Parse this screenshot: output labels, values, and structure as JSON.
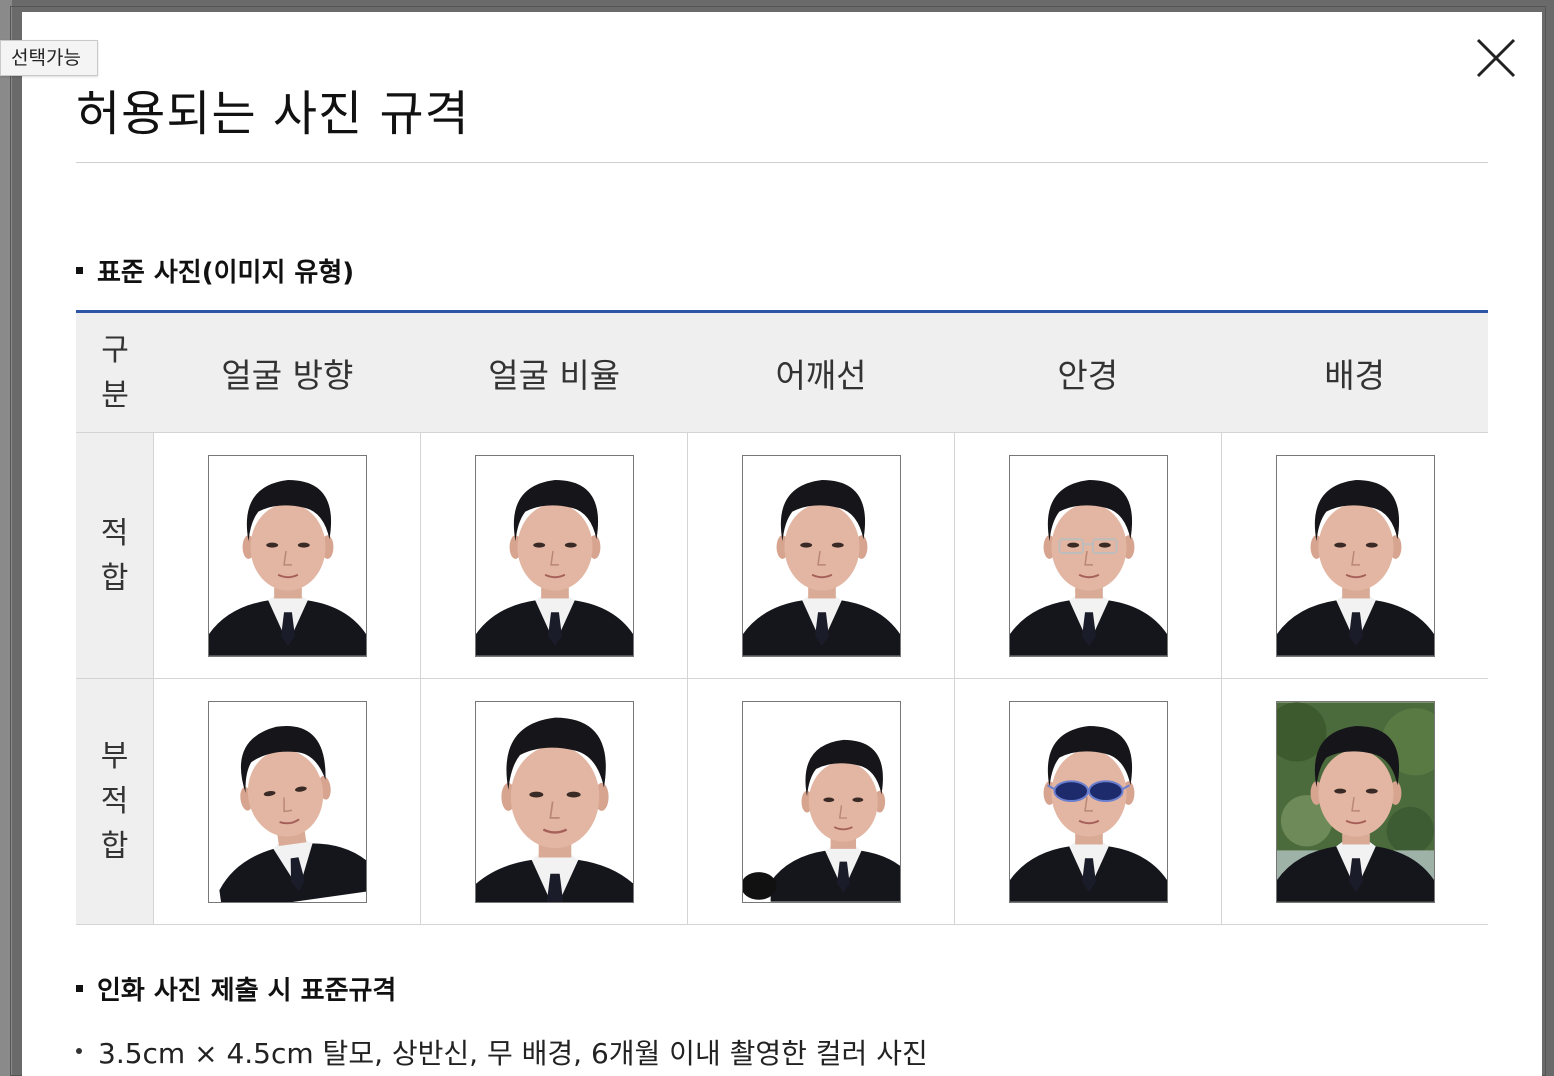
{
  "tooltip": "선택가능",
  "modal": {
    "title": "허용되는 사진 규격",
    "close_label": "닫기"
  },
  "section1": {
    "heading": "표준 사진(이미지 유형)"
  },
  "table": {
    "corner_label": "구분",
    "columns": [
      "얼굴 방향",
      "얼굴 비율",
      "어깨선",
      "안경",
      "배경"
    ],
    "rows": [
      {
        "label": "적합"
      },
      {
        "label": "부적합"
      }
    ]
  },
  "section2": {
    "heading": "인화 사진 제출 시 표준규격",
    "bullets": [
      "3.5cm × 4.5cm 탈모, 상반신, 무 배경, 6개월 이내 촬영한 컬러 사진"
    ]
  },
  "colors": {
    "table_top_border": "#2d55a5",
    "header_bg": "#efefef"
  }
}
